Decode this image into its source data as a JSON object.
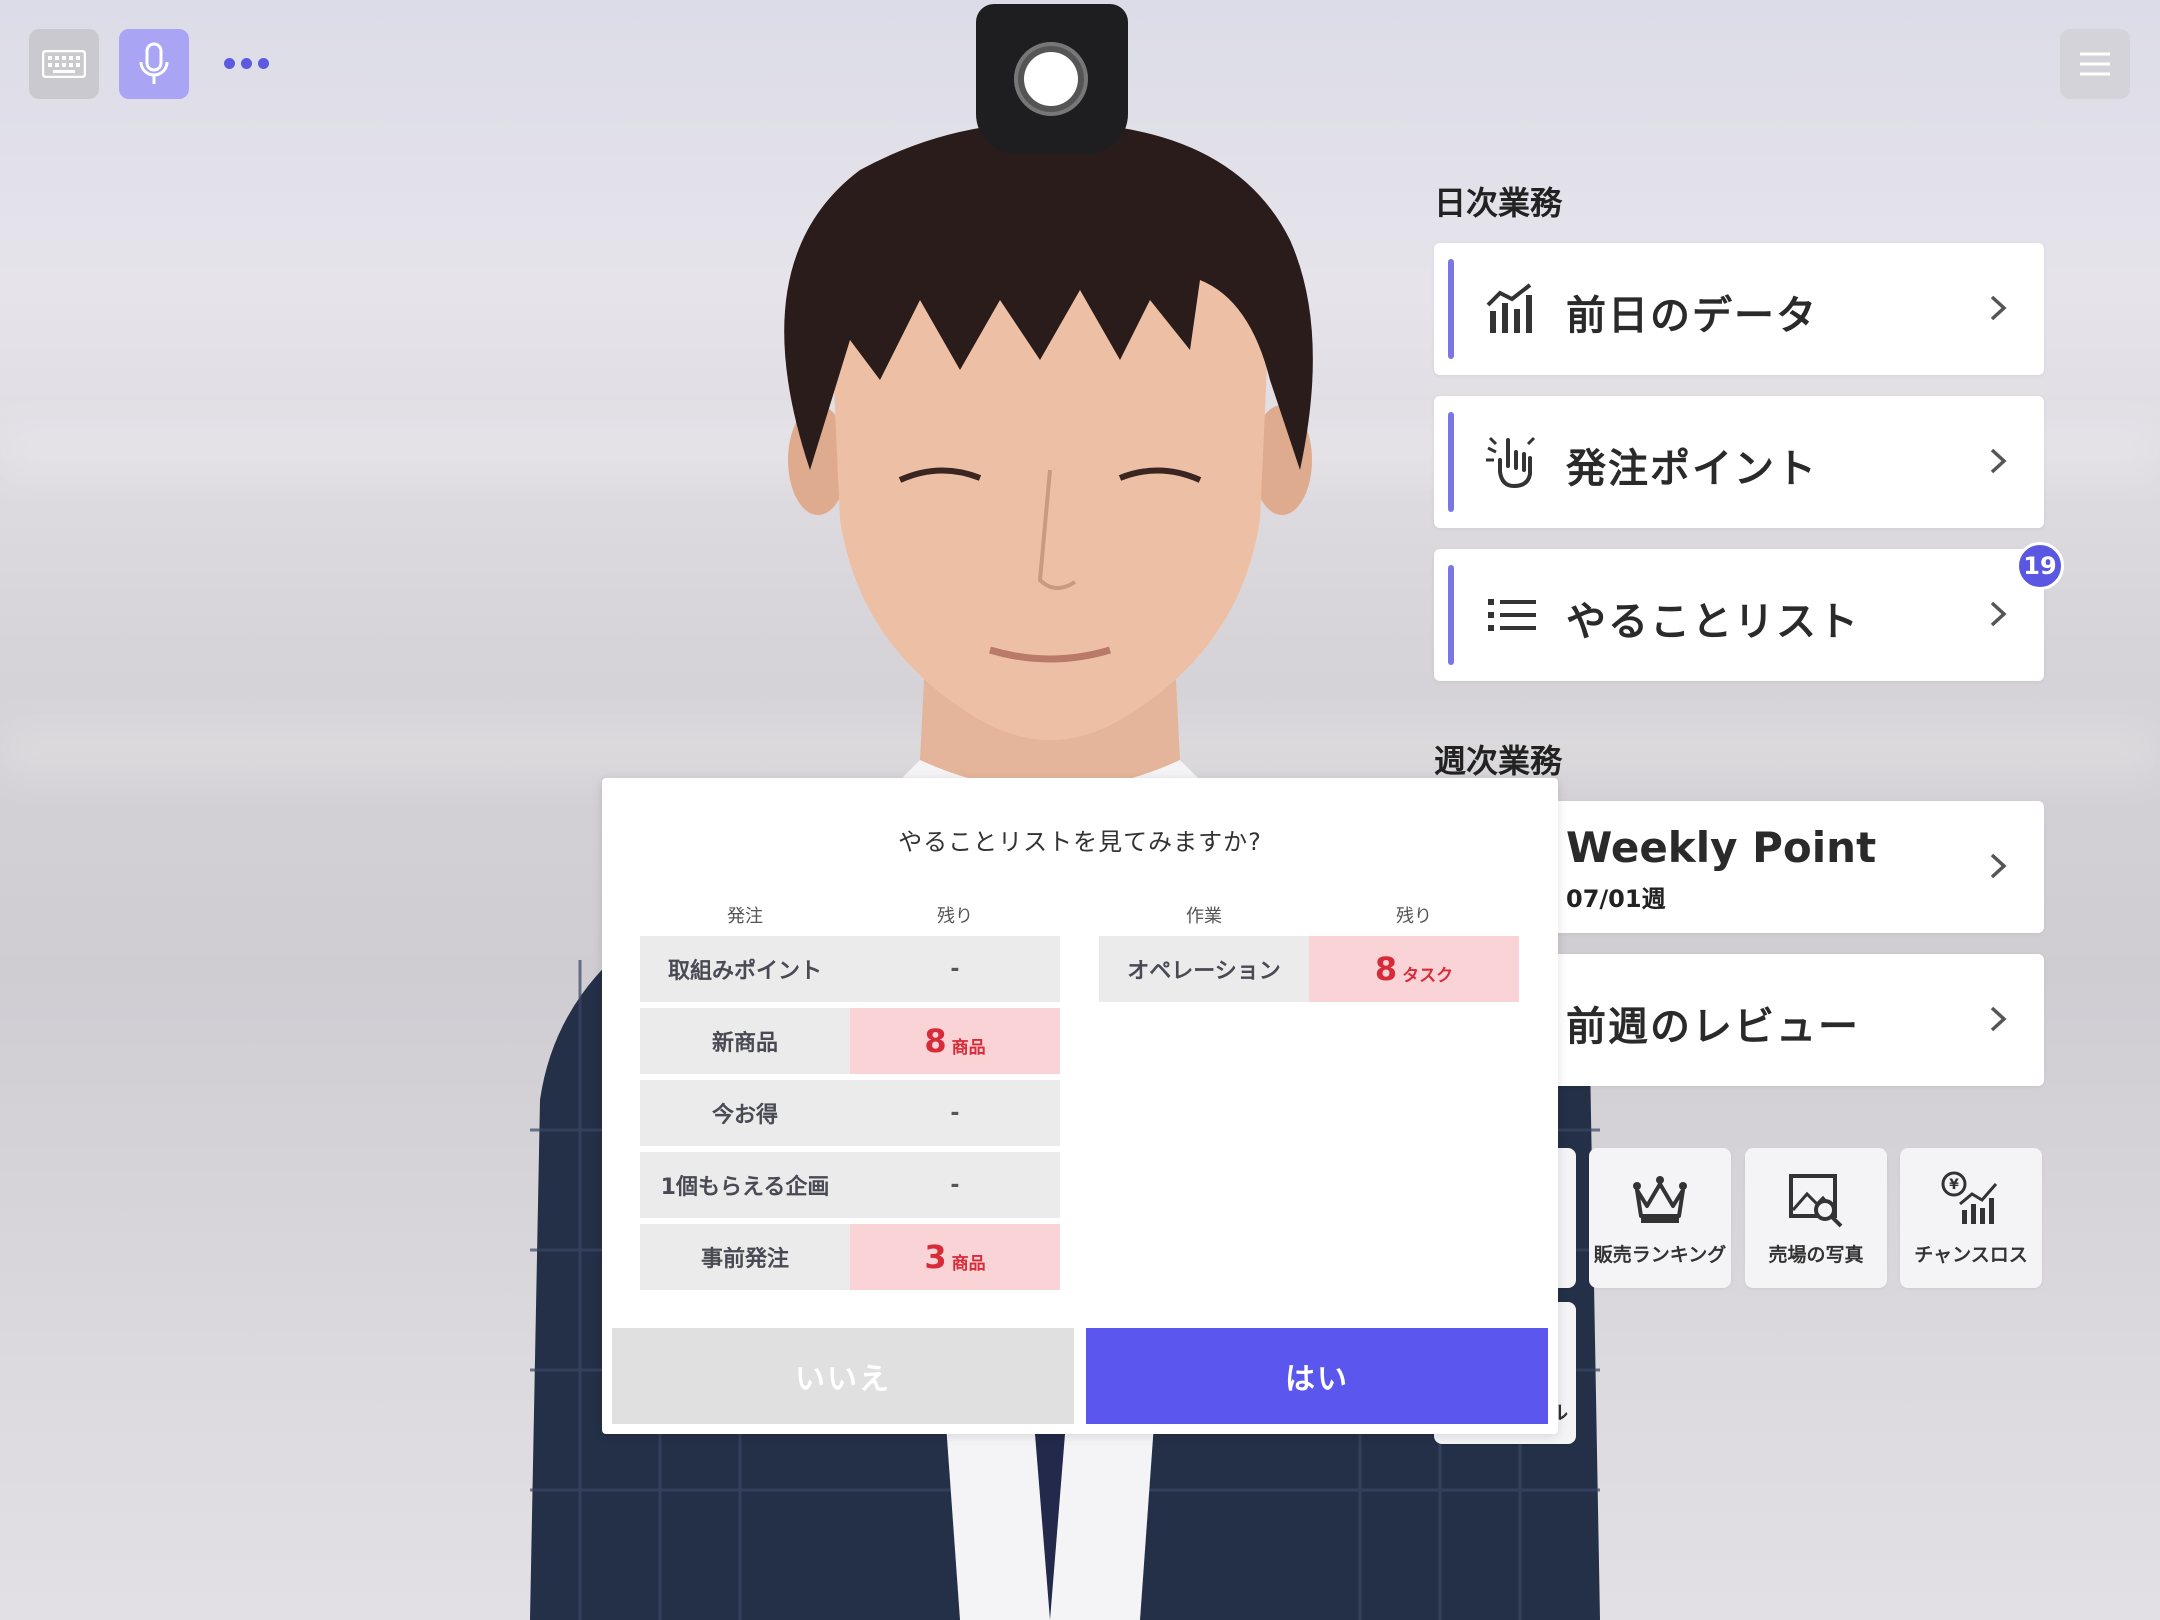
{
  "toolbar": {
    "keyboard_icon": "keyboard-icon",
    "mic_icon": "mic-icon",
    "more_icon": "more-dots-icon",
    "menu_icon": "hamburger-menu-icon"
  },
  "daily": {
    "title": "日次業務",
    "items": [
      {
        "label": "前日のデータ",
        "icon": "bar-chart-icon"
      },
      {
        "label": "発注ポイント",
        "icon": "hand-point-icon"
      },
      {
        "label": "やることリスト",
        "icon": "list-icon",
        "badge": "19"
      }
    ]
  },
  "weekly": {
    "title": "週次業務",
    "items": [
      {
        "label": "Weekly Point",
        "sublabel": "07/01週"
      },
      {
        "label": "前週のレビュー"
      }
    ]
  },
  "tiles": [
    {
      "label": "販売ランキング",
      "icon": "crown-icon"
    },
    {
      "label": "売場の写真",
      "icon": "photo-search-icon"
    },
    {
      "label": "チャンスロス",
      "icon": "yen-chart-icon"
    }
  ],
  "partial_tile_text": "ル",
  "dialog": {
    "question": "やることリストを見てみますか?",
    "left_headers": [
      "発注",
      "残り"
    ],
    "right_headers": [
      "作業",
      "残り"
    ],
    "left_rows": [
      {
        "name": "取組みポイント",
        "num": "-",
        "unit": "",
        "hot": false
      },
      {
        "name": "新商品",
        "num": "8",
        "unit": "商品",
        "hot": true
      },
      {
        "name": "今お得",
        "num": "-",
        "unit": "",
        "hot": false
      },
      {
        "name": "1個もらえる企画",
        "num": "-",
        "unit": "",
        "hot": false
      },
      {
        "name": "事前発注",
        "num": "3",
        "unit": "商品",
        "hot": true
      }
    ],
    "right_rows": [
      {
        "name": "オペレーション",
        "num": "8",
        "unit": "タスク",
        "hot": true
      }
    ],
    "no_label": "いいえ",
    "yes_label": "はい"
  },
  "colors": {
    "accent": "#5b57ee",
    "highlight_bg": "#f9d3d6",
    "highlight_text": "#d82b3a"
  }
}
